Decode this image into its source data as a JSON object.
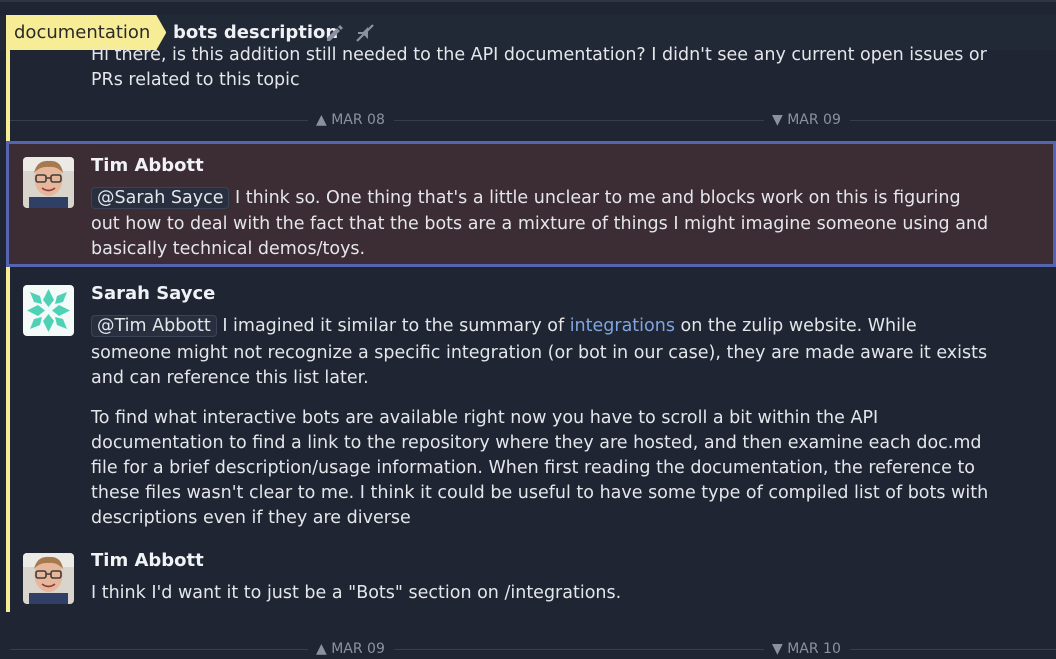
{
  "header": {
    "stream": "documentation",
    "topic": "bots description"
  },
  "first_message": {
    "line1": "Hi there, is this addition still needed to the API documentation? I didn't see any current open issues or",
    "line2": "PRs related to this topic"
  },
  "date_dividers": [
    {
      "left": "MAR 08",
      "right": "MAR 09"
    },
    {
      "left": "MAR 09",
      "right": "MAR 10"
    }
  ],
  "messages": [
    {
      "sender": "Tim Abbott",
      "mention": "@Sarah Sayce",
      "line1": " I think so. One thing that's a little unclear to me and blocks work on this is figuring",
      "line2": "out how to deal with the fact that the bots are a mixture of things I might imagine someone using and",
      "line3": "basically technical demos/toys."
    },
    {
      "sender": "Sarah Sayce",
      "mention": "@Tim Abbott",
      "line1_a": " I imagined it similar to the summary of ",
      "link": "integrations",
      "line1_b": " on the zulip website. While",
      "line2": "someone might not recognize a specific integration (or bot in our case), they are made aware it exists",
      "line3": "and can reference this list later.",
      "para2": [
        "To find what interactive bots are available right now you have to scroll a bit within the API",
        "documentation to find a link to the repository where they are hosted, and then examine each doc.md",
        "file for a brief description/usage information. When first reading the documentation, the reference to",
        "these files wasn't clear to me. I think it could be useful to have some type of compiled list of bots with",
        "descriptions even if they are diverse"
      ]
    },
    {
      "sender": "Tim Abbott",
      "line1": "I think I'd want it to just be a \"Bots\" section on /integrations."
    }
  ],
  "colors": {
    "stream": "#f7ed96",
    "selected_border": "#5664b0",
    "link": "#7fa6e0"
  }
}
